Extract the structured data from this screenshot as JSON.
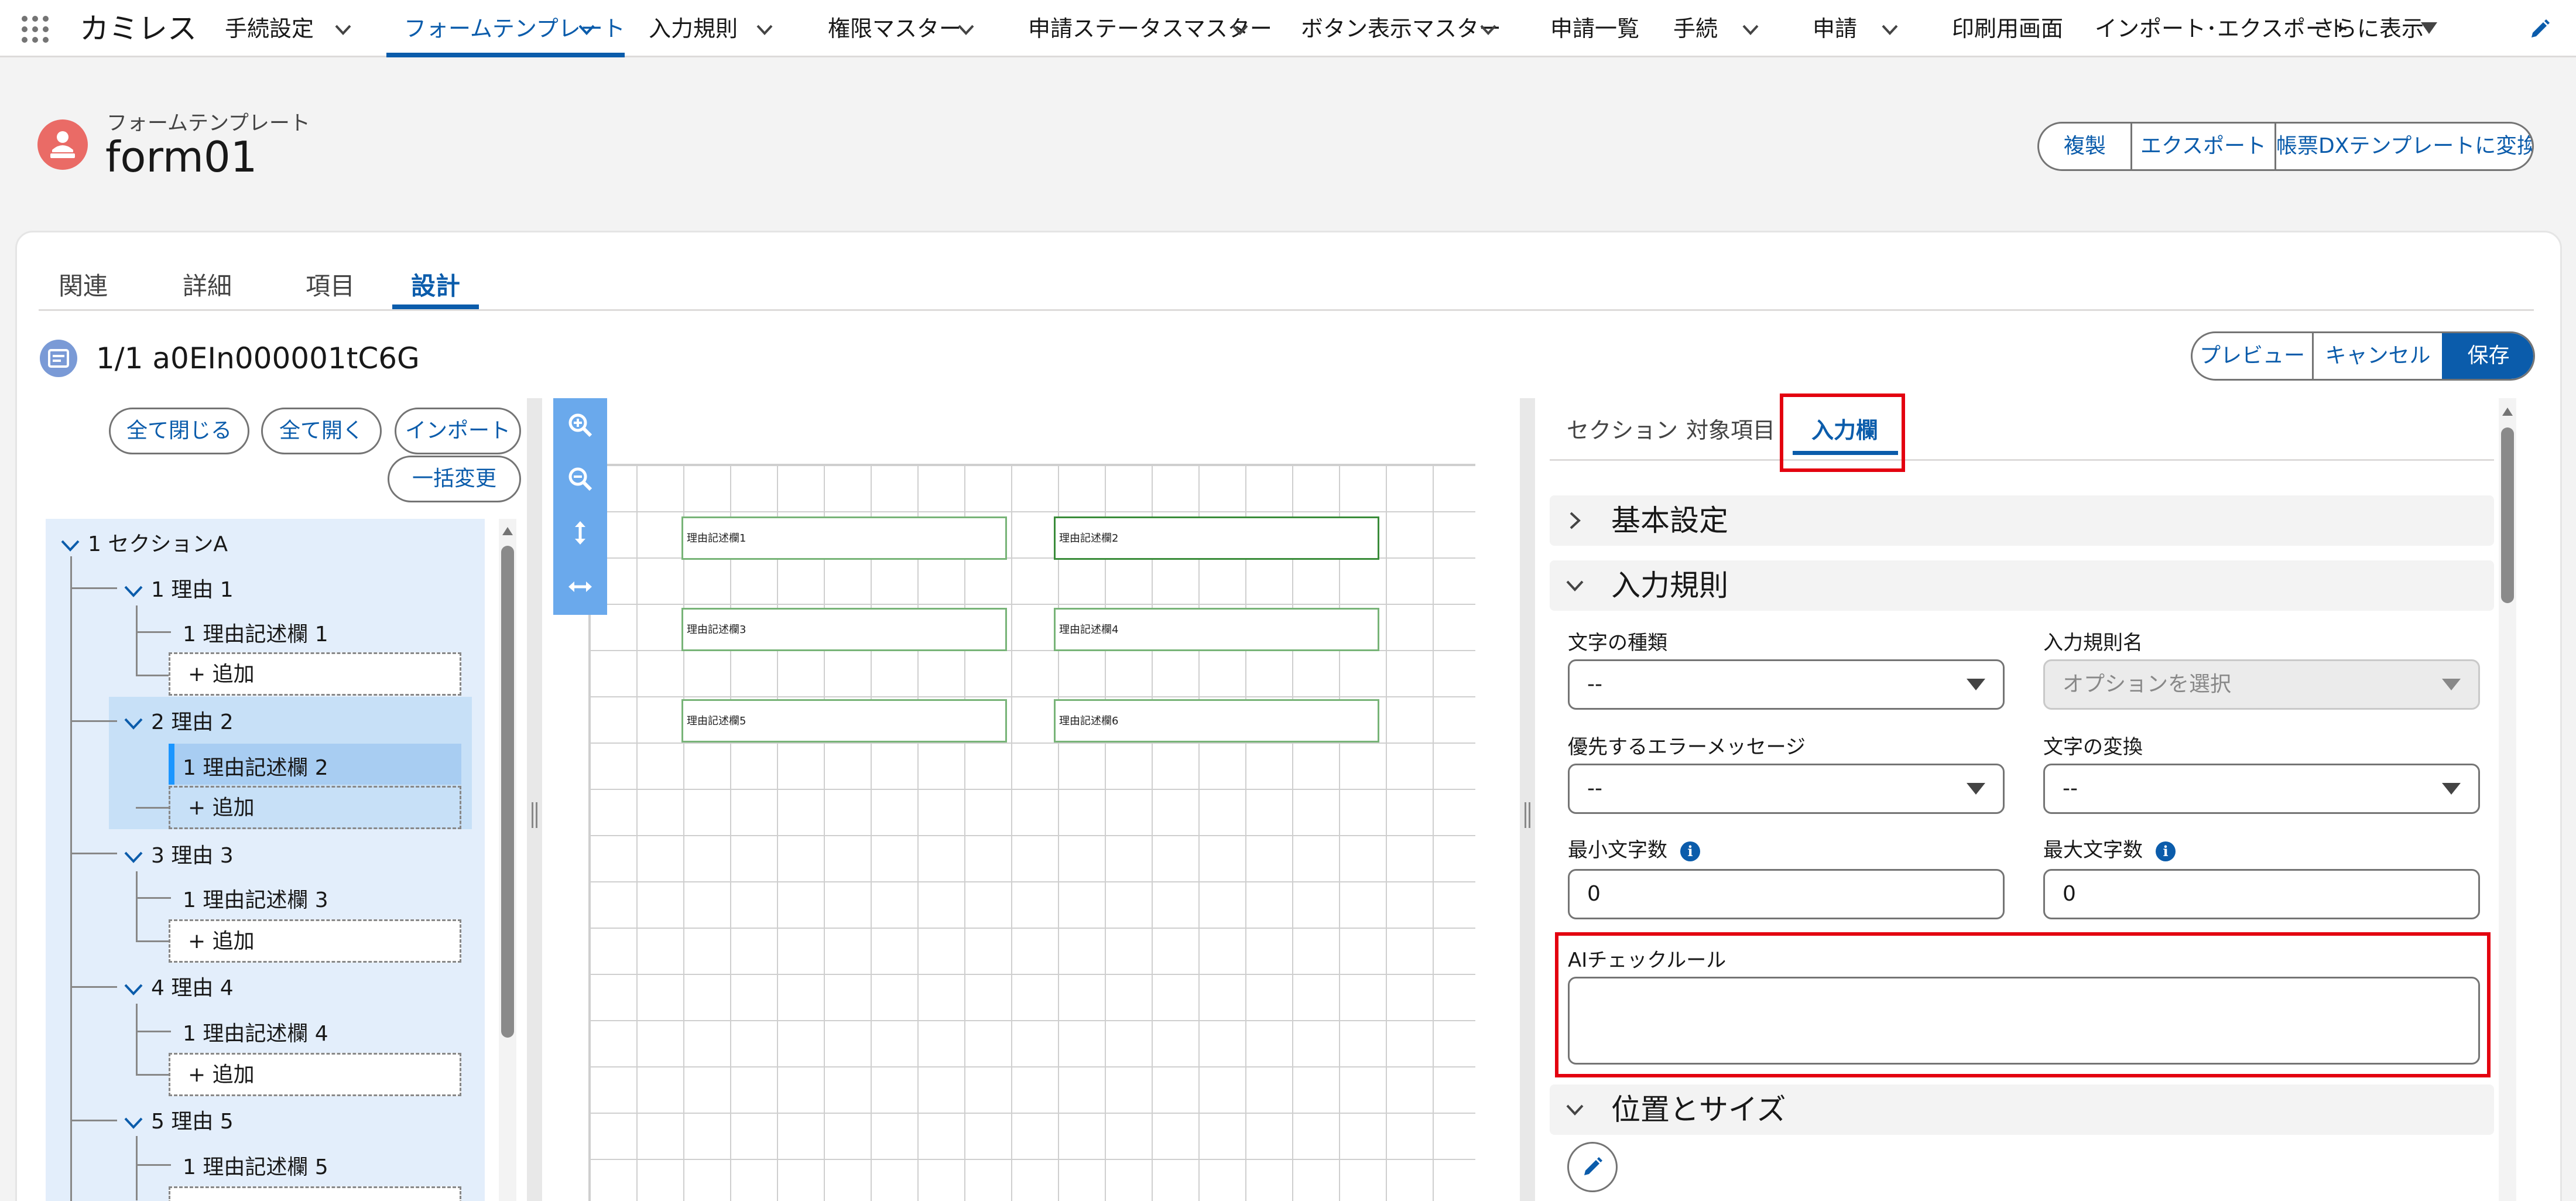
{
  "nav": {
    "app_name": "カミレス",
    "items": [
      {
        "label": "手続設定",
        "has_menu": true
      },
      {
        "label": "フォームテンプレート",
        "has_menu": true,
        "active": true
      },
      {
        "label": "入力規則",
        "has_menu": true
      },
      {
        "label": "権限マスター",
        "has_menu": true
      },
      {
        "label": "申請ステータスマスター",
        "has_menu": true
      },
      {
        "label": "ボタン表示マスター",
        "has_menu": true
      },
      {
        "label": "申請一覧",
        "has_menu": false
      },
      {
        "label": "手続",
        "has_menu": true
      },
      {
        "label": "申請",
        "has_menu": true
      },
      {
        "label": "印刷用画面",
        "has_menu": false
      },
      {
        "label": "インポート･エクスポート",
        "has_menu": false
      }
    ],
    "more_label": "さらに表示"
  },
  "record": {
    "object_label": "フォームテンプレート",
    "name": "form01",
    "actions": [
      "複製",
      "エクスポート",
      "帳票DXテンプレートに変換"
    ]
  },
  "tabs": [
    "関連",
    "詳細",
    "項目",
    "設計"
  ],
  "active_tab": "設計",
  "designer": {
    "title": "1/1 a0EIn000001tC6G",
    "actions": [
      "プレビュー",
      "キャンセル",
      "保存"
    ],
    "tree_buttons": [
      "全て閉じる",
      "全て開く",
      "インポート",
      "一括変更"
    ],
    "tree": {
      "root": "1 セクションA",
      "groups": [
        {
          "label": "1 理由 1",
          "child": "1 理由記述欄 1",
          "add": "+ 追加"
        },
        {
          "label": "2 理由 2",
          "child": "1 理由記述欄 2",
          "add": "+ 追加"
        },
        {
          "label": "3 理由 3",
          "child": "1 理由記述欄 3",
          "add": "+ 追加"
        },
        {
          "label": "4 理由 4",
          "child": "1 理由記述欄 4",
          "add": "+ 追加"
        },
        {
          "label": "5 理由 5",
          "child": "1 理由記述欄 5",
          "add": "+ 追加"
        }
      ]
    },
    "canvas_fields": [
      "理由記述欄1",
      "理由記述欄2",
      "理由記述欄3",
      "理由記述欄4",
      "理由記述欄5",
      "理由記述欄6"
    ],
    "tool_icons": [
      "zoom-in-icon",
      "zoom-out-icon",
      "fit-height-icon",
      "fit-width-icon"
    ]
  },
  "props": {
    "tabs": [
      "セクション",
      "対象項目",
      "入力欄"
    ],
    "active_tab": "入力欄",
    "sections": {
      "basic": "基本設定",
      "rules": "入力規則",
      "position": "位置とサイズ"
    },
    "fields": {
      "char_type": {
        "label": "文字の種類",
        "value": "--"
      },
      "rule_name": {
        "label": "入力規則名",
        "placeholder": "オプションを選択"
      },
      "error_msg": {
        "label": "優先するエラーメッセージ",
        "value": "--"
      },
      "char_convert": {
        "label": "文字の変換",
        "value": "--"
      },
      "min_chars": {
        "label": "最小文字数",
        "value": "0"
      },
      "max_chars": {
        "label": "最大文字数",
        "value": "0"
      },
      "ai_rule": {
        "label": "AIチェックルール",
        "value": ""
      }
    }
  },
  "colors": {
    "brand": "#0b5cab",
    "highlight": "#e3000f",
    "record_icon": "#ea6b66",
    "field_border": "#78b478"
  }
}
